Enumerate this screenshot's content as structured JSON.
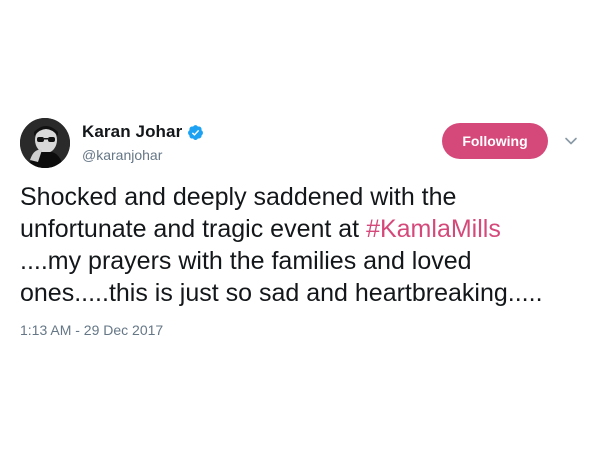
{
  "colors": {
    "accent": "#d5497a",
    "verified": "#1da1f2",
    "text_primary": "#14171a",
    "text_secondary": "#657786"
  },
  "user": {
    "display_name": "Karan Johar",
    "handle": "@karanjohar",
    "verified": true,
    "avatar_icon": "avatar-photo"
  },
  "actions": {
    "follow_label": "Following",
    "menu_icon": "chevron-down-icon"
  },
  "tweet": {
    "text_lines": [
      "Shocked and deeply saddened with the",
      "unfortunate and tragic event at ",
      "....my prayers with the families and loved",
      "ones.....this is just so sad and heartbreaking....."
    ],
    "hashtag": "#KamlaMills",
    "timestamp": "1:13 AM - 29 Dec 2017"
  }
}
